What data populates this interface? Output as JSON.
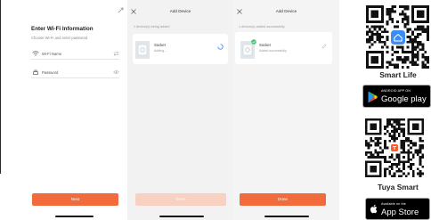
{
  "wifi_screen": {
    "title": "Enter Wi-Fi Information",
    "subtitle": "Choose Wi-Fi and enter password",
    "wifi_name": "Wi-Fi Name",
    "password": "Password",
    "next_label": "Next",
    "icons": {
      "top_right": "expand-icon",
      "wifi": "wifi-icon",
      "switch": "switch-icon",
      "lock": "lock-icon",
      "eye": "eye-icon"
    }
  },
  "adding_screen": {
    "title": "Add Device",
    "status": "1 device(s) being added",
    "device_name": "Socket",
    "device_status": "Adding...",
    "done_label": "Done",
    "icons": {
      "close": "close-icon",
      "progress": "loading-icon"
    }
  },
  "added_screen": {
    "title": "Add Device",
    "status": "1 device(s) added successfully",
    "device_name": "Socket",
    "device_status": "Added successfully",
    "done_label": "Done",
    "icons": {
      "close": "close-icon",
      "badge": "check-icon",
      "edit": "edit-icon"
    }
  },
  "downloads": {
    "smart_life": {
      "label": "Smart Life",
      "store_caption": "ANDROID APP ON",
      "store_name": "Google play",
      "icon": "google-play-icon"
    },
    "tuya_smart": {
      "label": "Tuya Smart",
      "store_caption": "Available on the",
      "store_name": "App Store",
      "icon": "apple-icon"
    }
  },
  "colors": {
    "accent": "#f26b3c",
    "accent_disabled": "#f9d1c2",
    "smart_life_blue": "#3b8cf6",
    "success_green": "#3cc46f",
    "loading_blue": "#3d8ff5"
  }
}
